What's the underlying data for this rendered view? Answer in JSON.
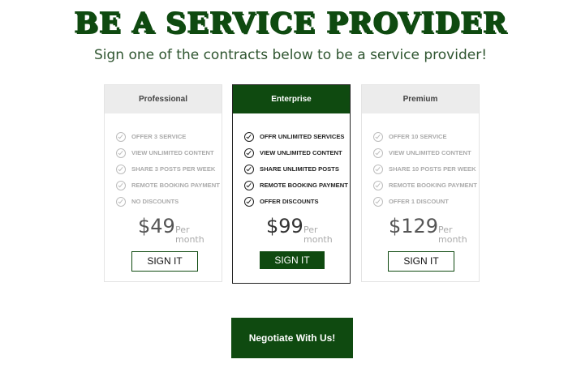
{
  "header": {
    "title": "BE A SERVICE PROVIDER",
    "subtitle": "Sign one of the contracts below to be a service provider!"
  },
  "plans": [
    {
      "name": "Professional",
      "features": [
        "OFFER 3 SERVICE",
        "VIEW UNLIMITED CONTENT",
        "SHARE 3 POSTS PER WEEK",
        "REMOTE BOOKING PAYMENT",
        "NO DISCOUNTS"
      ],
      "price": "$49",
      "per_line1": "Per",
      "per_line2": "month",
      "button_label": "SIGN IT"
    },
    {
      "name": "Enterprise",
      "features": [
        "OFFR UNLIMITED SERVICES",
        "VIEW UNLIMITED CONTENT",
        "SHARE UNLIMITED POSTS",
        "REMOTE BOOKING PAYMENT",
        "OFFER DISCOUNTS"
      ],
      "price": "$99",
      "per_line1": "Per",
      "per_line2": "month",
      "button_label": "SIGN IT"
    },
    {
      "name": "Premium",
      "features": [
        "OFFER 10  SERVICE",
        "VIEW UNLIMITED CONTENT",
        "SHARE 10  POSTS PER WEEK",
        "REMOTE BOOKING PAYMENT",
        "OFFER 1 DISCOUNT"
      ],
      "price": "$129",
      "per_line1": "Per",
      "per_line2": "month",
      "button_label": "SIGN IT"
    }
  ],
  "cta": {
    "label": "Negotiate With Us!"
  },
  "icons": {
    "feature": "check-circle-icon"
  },
  "colors": {
    "brand": "#0f4a10",
    "header_bg": "#ececec",
    "muted": "#aaaaaa"
  }
}
